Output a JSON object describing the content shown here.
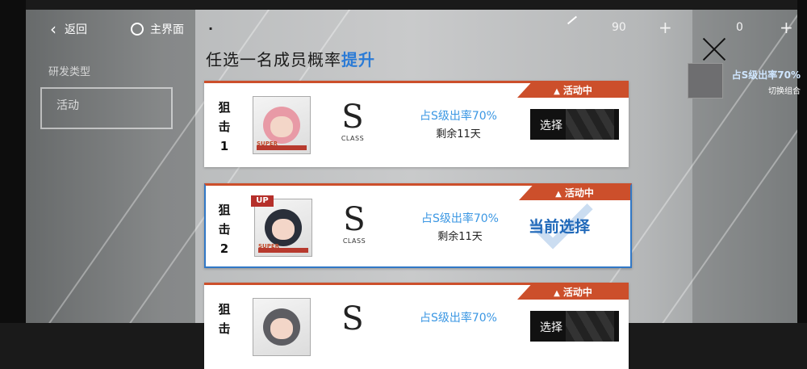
{
  "topbar": {
    "back_label": "返回",
    "home_label": "主界面",
    "resource1_value": "90",
    "resource2_value": "0"
  },
  "background": {
    "left_label": "研发类型",
    "left_active": "活动",
    "right_rate": "占S级出率70%",
    "right_switch": "切换组合"
  },
  "dialog": {
    "title_prefix": "任选一名成员概率",
    "title_highlight": "提升",
    "cards": [
      {
        "class_label": "狙击1",
        "tag": "SUPER",
        "grade": "S",
        "grade_sub": "CLASS",
        "rate": "占S级出率70%",
        "remaining": "剩余11天",
        "badge": "活动中",
        "action": "选择",
        "selected": false
      },
      {
        "class_label": "狙击2",
        "up": "UP",
        "tag": "SUPER",
        "grade": "S",
        "grade_sub": "CLASS",
        "rate": "占S级出率70%",
        "remaining": "剩余11天",
        "badge": "活动中",
        "action": "当前选择",
        "selected": true
      },
      {
        "class_label": "狙击",
        "grade": "S",
        "rate": "占S级出率70%",
        "badge": "活动中",
        "action": "选择",
        "selected": false
      }
    ]
  },
  "colors": {
    "accent_red": "#cc4f2b",
    "highlight_blue": "#2b7bd6",
    "rate_blue": "#3b97e3"
  },
  "icons": [
    "back-arrow-icon",
    "home-circle-icon",
    "close-icon",
    "badge-arrow-icon",
    "checkmark-icon"
  ]
}
